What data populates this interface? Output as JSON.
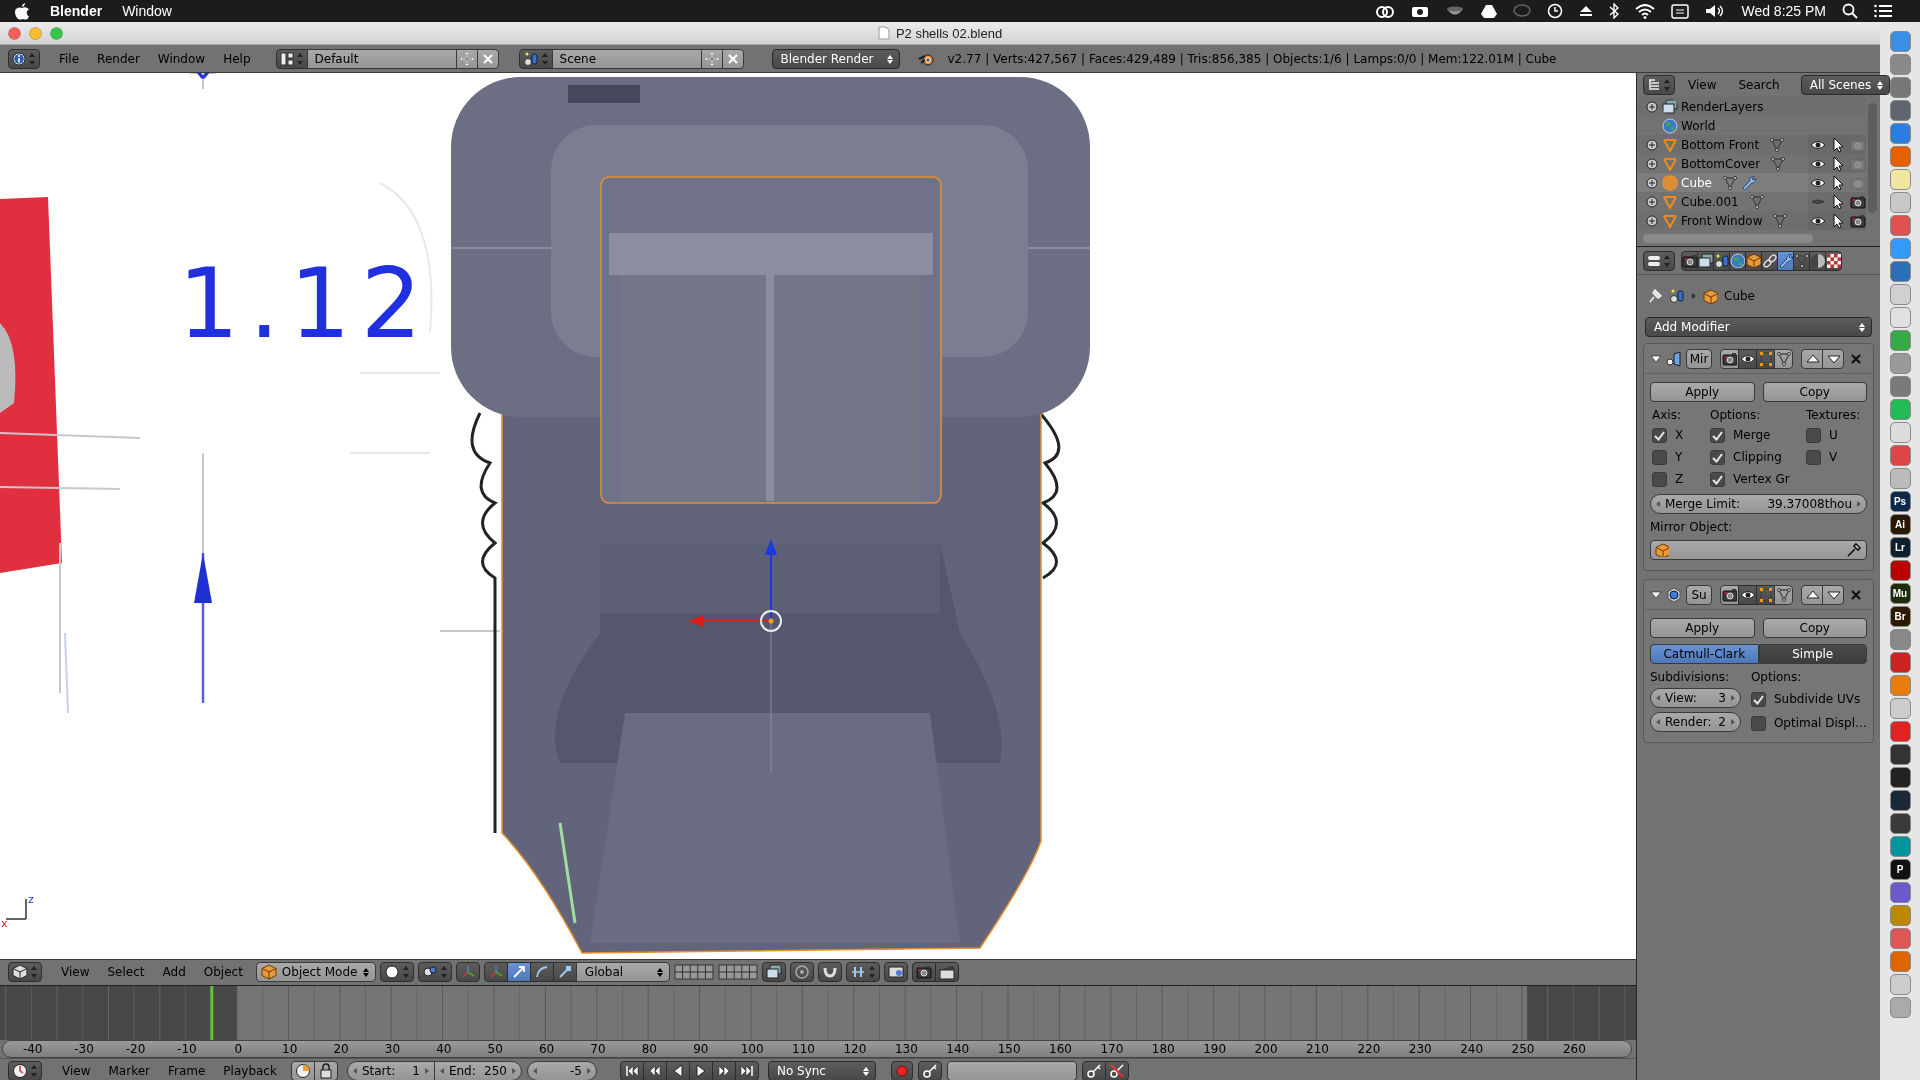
{
  "menu_bar": {
    "app": "Blender",
    "menus": [
      "Window"
    ],
    "clock": "Wed 8:25 PM"
  },
  "window": {
    "title": "P2 shells 02.blend"
  },
  "info_header": {
    "menus": [
      "File",
      "Render",
      "Window",
      "Help"
    ],
    "layout": "Default",
    "scene": "Scene",
    "render_engine": "Blender Render",
    "stats": "v2.77 | Verts:427,567 | Faces:429,489 | Tris:856,385 | Objects:1/6 | Lamps:0/0 | Mem:122.01M | Cube"
  },
  "viewport": {
    "reference_label": "1.12",
    "axis_labels": [
      "z",
      "x"
    ],
    "header": {
      "menus": [
        "View",
        "Select",
        "Add",
        "Object"
      ],
      "mode": "Object Mode",
      "orientation": "Global"
    }
  },
  "timeline": {
    "ruler": [
      "-40",
      "-30",
      "-20",
      "-10",
      "0",
      "10",
      "20",
      "30",
      "40",
      "50",
      "60",
      "70",
      "80",
      "90",
      "100",
      "110",
      "120",
      "130",
      "140",
      "150",
      "160",
      "170",
      "180",
      "190",
      "200",
      "210",
      "220",
      "230",
      "240",
      "250",
      "260"
    ],
    "header": {
      "menus": [
        "View",
        "Marker",
        "Frame",
        "Playback"
      ],
      "start_label": "Start:",
      "start": "1",
      "end_label": "End:",
      "end": "250",
      "current": "-5",
      "sync": "No Sync"
    }
  },
  "outliner": {
    "header": {
      "menus": [
        "View",
        "Search"
      ],
      "filter": "All Scenes"
    },
    "items": [
      {
        "kind": "layers",
        "name": "RenderLayers",
        "selected": false
      },
      {
        "kind": "world",
        "name": "World",
        "selected": false
      },
      {
        "kind": "mesh",
        "name": "Bottom Front",
        "selected": false,
        "visible": true,
        "renderable": false,
        "modifiers": false
      },
      {
        "kind": "mesh",
        "name": "BottomCover",
        "selected": false,
        "visible": true,
        "renderable": false,
        "modifiers": false
      },
      {
        "kind": "mesh",
        "name": "Cube",
        "selected": true,
        "visible": true,
        "renderable": false,
        "modifiers": true
      },
      {
        "kind": "mesh",
        "name": "Cube.001",
        "selected": false,
        "visible": false,
        "renderable": true,
        "modifiers": false
      },
      {
        "kind": "mesh",
        "name": "Front Window",
        "selected": false,
        "visible": true,
        "renderable": true,
        "modifiers": false
      }
    ]
  },
  "properties": {
    "tabs": [
      {
        "kind": "render",
        "selected": false
      },
      {
        "kind": "layers",
        "selected": false
      },
      {
        "kind": "scene",
        "selected": false
      },
      {
        "kind": "world",
        "selected": false
      },
      {
        "kind": "object",
        "selected": false
      },
      {
        "kind": "constraints",
        "selected": false
      },
      {
        "kind": "modifiers",
        "selected": true
      },
      {
        "kind": "data",
        "selected": false
      },
      {
        "kind": "material",
        "selected": false
      },
      {
        "kind": "texture",
        "selected": false
      }
    ],
    "context": "Cube",
    "add_modifier": "Add Modifier",
    "modifiers": [
      {
        "kind": "mirror",
        "name": "Mir",
        "expanded": true,
        "apply": "Apply",
        "copy": "Copy",
        "axis_label": "Axis:",
        "options_label": "Options:",
        "textures_label": "Textures:",
        "axis": [
          {
            "label": "X",
            "checked": true
          },
          {
            "label": "Y",
            "checked": false
          },
          {
            "label": "Z",
            "checked": false
          }
        ],
        "options": [
          {
            "label": "Merge",
            "checked": true
          },
          {
            "label": "Clipping",
            "checked": true
          },
          {
            "label": "Vertex Gr",
            "checked": true
          }
        ],
        "textures": [
          {
            "label": "U",
            "checked": false
          },
          {
            "label": "V",
            "checked": false
          }
        ],
        "merge_limit": {
          "label": "Merge Limit:",
          "value": "39.37008thou"
        },
        "mirror_object_label": "Mirror Object:"
      },
      {
        "kind": "subsurf",
        "name": "Su",
        "expanded": true,
        "apply": "Apply",
        "copy": "Copy",
        "algorithms": [
          {
            "label": "Catmull-Clark",
            "selected": true
          },
          {
            "label": "Simple",
            "selected": false
          }
        ],
        "subdivisions_label": "Subdivisions:",
        "options_label": "Options:",
        "levels": [
          {
            "label": "View:",
            "value": "3"
          },
          {
            "label": "Render:",
            "value": "2"
          }
        ],
        "options": [
          {
            "label": "Subdivide UVs",
            "checked": true
          },
          {
            "label": "Optimal Displ…",
            "checked": false
          }
        ]
      }
    ]
  },
  "dock": [
    {
      "color": "#3a8ee6"
    },
    {
      "color": "#8a8a8a"
    },
    {
      "color": "#777777"
    },
    {
      "color": "#5f6670"
    },
    {
      "color": "#2a7de1"
    },
    {
      "color": "#e66000"
    },
    {
      "color": "#f0e6a0"
    },
    {
      "color": "#c8c8c8"
    },
    {
      "color": "#e05050"
    },
    {
      "color": "#3399ff"
    },
    {
      "color": "#2a6fb8"
    },
    {
      "color": "#d0d0d0"
    },
    {
      "color": "#e0e0e0"
    },
    {
      "color": "#33aa44"
    },
    {
      "color": "#999999"
    },
    {
      "color": "#7a7a7a"
    },
    {
      "color": "#22bb55"
    },
    {
      "color": "#dddddd"
    },
    {
      "color": "#e04444"
    },
    {
      "color": "#bbbbbb"
    },
    {
      "color": "#0b2a4a",
      "label": "Ps"
    },
    {
      "color": "#2b1800",
      "label": "Ai"
    },
    {
      "color": "#0f1f2f",
      "label": "Lr"
    },
    {
      "color": "#bb0000"
    },
    {
      "color": "#1d2d0b",
      "label": "Mu"
    },
    {
      "color": "#2b1a00",
      "label": "Br"
    },
    {
      "color": "#888888"
    },
    {
      "color": "#cc2222"
    },
    {
      "color": "#e87d0d"
    },
    {
      "color": "#cccccc"
    },
    {
      "color": "#e02222"
    },
    {
      "color": "#333333"
    },
    {
      "color": "#222222"
    },
    {
      "color": "#1b2838"
    },
    {
      "color": "#3a3a3a"
    },
    {
      "color": "#00979c"
    },
    {
      "color": "#111111",
      "label": "P"
    },
    {
      "color": "#6a5acd"
    },
    {
      "color": "#bb8800"
    },
    {
      "color": "#e05555"
    },
    {
      "color": "#dd6600"
    },
    {
      "color": "#cccccc"
    },
    {
      "color": "#aaaaaa"
    }
  ]
}
